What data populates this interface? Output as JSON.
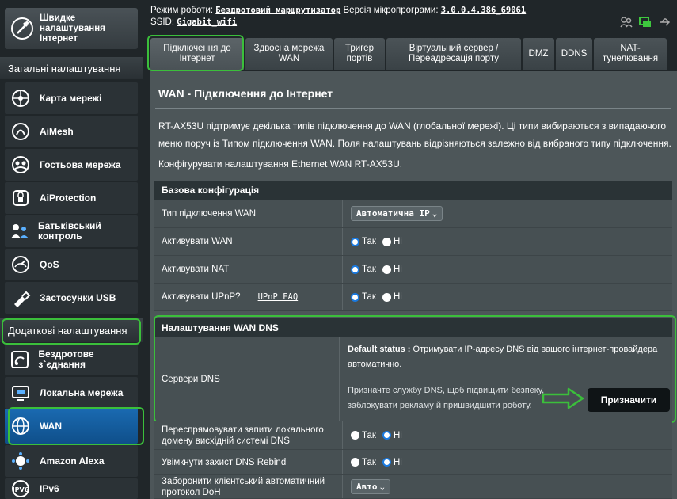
{
  "header": {
    "mode_label": "Режим роботи:",
    "mode_value": "Бездротовий маршрутизатор",
    "fw_label": "Версія мікропрограми:",
    "fw_value": "3.0.0.4.386_69061",
    "ssid_label": "SSID:",
    "ssid_value": "Gigabit_wifi"
  },
  "sidebar": {
    "quick_setup": "Швидке налаштування Інтернет",
    "general_title": "Загальні налаштування",
    "general_items": [
      {
        "label": "Карта мережі",
        "icon": "network-map-icon"
      },
      {
        "label": "AiMesh",
        "icon": "aimesh-icon"
      },
      {
        "label": "Гостьова мережа",
        "icon": "guest-network-icon"
      },
      {
        "label": "AiProtection",
        "icon": "aiprotection-icon"
      },
      {
        "label": "Батьківський контроль",
        "icon": "parental-control-icon"
      },
      {
        "label": "QoS",
        "icon": "qos-icon"
      },
      {
        "label": "Застосунки USB",
        "icon": "usb-icon"
      }
    ],
    "advanced_title": "Додаткові налаштування",
    "advanced_items": [
      {
        "label": "Бездротове з`єднання",
        "icon": "wireless-icon"
      },
      {
        "label": "Локальна мережа",
        "icon": "lan-icon"
      },
      {
        "label": "WAN",
        "icon": "wan-icon"
      },
      {
        "label": "Amazon Alexa",
        "icon": "alexa-icon"
      },
      {
        "label": "IPv6",
        "icon": "ipv6-icon"
      }
    ]
  },
  "tabs": [
    "Підключення до Інтернет",
    "Здвоєна мережа WAN",
    "Тригер портів",
    "Віртуальний сервер / Переадресація порту",
    "DMZ",
    "DDNS",
    "NAT-тунелювання"
  ],
  "main": {
    "title": "WAN - Підключення до Інтернет",
    "description": "RT-AX53U підтримує декілька типів підключення до WAN (глобальної мережі). Ці типи вибираються з випадаючого меню поруч із Типом підключення WAN. Поля налаштувань відрізняються залежно від вибраного типу підключення.",
    "config_note": "Конфігурувати налаштування Ethernet WAN RT-AX53U.",
    "basic_title": "Базова конфігурація",
    "wan_type_label": "Тип підключення WAN",
    "wan_type_value": "Автоматична IP",
    "enable_wan_label": "Активувати WAN",
    "enable_nat_label": "Активувати NAT",
    "enable_upnp_label": "Активувати UPnP?",
    "upnp_faq": "UPnP FAQ",
    "yes": "Так",
    "no": "Ні",
    "dns_title": "Налаштування WAN DNS",
    "dns_servers_label": "Сервери DNS",
    "default_status_label": "Default status :",
    "default_status_text": "Отримувати IP-адресу DNS від вашого інтернет-провайдера автоматично.",
    "assign_hint": "Призначте службу DNS, щоб підвищити безпеку, заблокувати рекламу й пришвидшити роботу.",
    "assign_button": "Призначити",
    "forward_dns_label": "Переспрямовувати запити локального домену висхідній системі DNS",
    "rebind_label": "Увімкнути захист DNS Rebind",
    "doh_label": "Заборонити клієнтський автоматичний протокол DoH",
    "doh_value": "Авто"
  },
  "colors": {
    "accent_blue": "#1a6ab1",
    "highlight_green": "#3bbf3b"
  }
}
